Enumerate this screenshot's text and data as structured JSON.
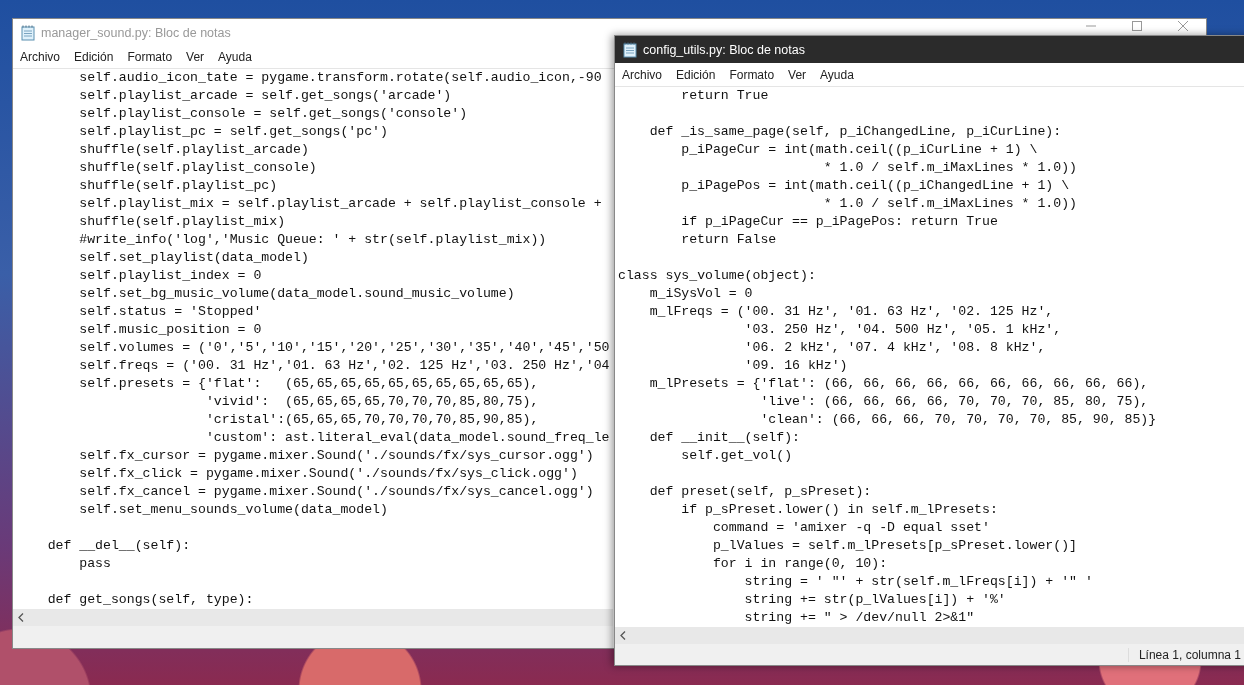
{
  "windows": [
    {
      "title": "manager_sound.py: Bloc de notas",
      "active": false,
      "menu": [
        "Archivo",
        "Edición",
        "Formato",
        "Ver",
        "Ayuda"
      ],
      "blocks": [
        [
          "        self.audio_icon_tate = pygame.transform.rotate(self.audio_icon,-90",
          "        self.playlist_arcade = self.get_songs('arcade')",
          "        self.playlist_console = self.get_songs('console')",
          "        self.playlist_pc = self.get_songs('pc')",
          "        shuffle(self.playlist_arcade)",
          "        shuffle(self.playlist_console)",
          "        shuffle(self.playlist_pc)",
          "        self.playlist_mix = self.playlist_arcade + self.playlist_console +",
          "        shuffle(self.playlist_mix)",
          "        #write_info('log','Music Queue: ' + str(self.playlist_mix))",
          "        self.set_playlist(data_model)",
          "        self.playlist_index = 0",
          "        self.set_bg_music_volume(data_model.sound_music_volume)",
          "        self.status = 'Stopped'",
          "        self.music_position = 0",
          "        self.volumes = ('0','5','10','15','20','25','30','35','40','45','50",
          "        self.freqs = ('00. 31 Hz','01. 63 Hz','02. 125 Hz','03. 250 Hz','04",
          "        self.presets = {'flat':   (65,65,65,65,65,65,65,65,65,65),",
          "                        'vivid':  (65,65,65,65,70,70,70,85,80,75),",
          "                        'cristal':(65,65,65,70,70,70,70,85,90,85),",
          "                        'custom': ast.literal_eval(data_model.sound_freq_le",
          "        self.fx_cursor = pygame.mixer.Sound('./sounds/fx/sys_cursor.ogg')",
          "        self.fx_click = pygame.mixer.Sound('./sounds/fx/sys_click.ogg')",
          "        self.fx_cancel = pygame.mixer.Sound('./sounds/fx/sys_cancel.ogg')",
          "        self.set_menu_sounds_volume(data_model)"
        ],
        [
          "    def __del__(self):",
          "        pass"
        ],
        [
          "    def get_songs(self, type):"
        ]
      ]
    },
    {
      "title": "config_utils.py: Bloc de notas",
      "active": true,
      "menu": [
        "Archivo",
        "Edición",
        "Formato",
        "Ver",
        "Ayuda"
      ],
      "blocks": [
        [
          "        return True"
        ],
        [
          "    def _is_same_page(self, p_iChangedLine, p_iCurLine):",
          "        p_iPageCur = int(math.ceil((p_iCurLine + 1) \\",
          "                          * 1.0 / self.m_iMaxLines * 1.0))",
          "        p_iPagePos = int(math.ceil((p_iChangedLine + 1) \\",
          "                          * 1.0 / self.m_iMaxLines * 1.0))",
          "        if p_iPageCur == p_iPagePos: return True",
          "        return False"
        ],
        [
          "class sys_volume(object):",
          "    m_iSysVol = 0",
          "    m_lFreqs = ('00. 31 Hz', '01. 63 Hz', '02. 125 Hz',",
          "                '03. 250 Hz', '04. 500 Hz', '05. 1 kHz',",
          "                '06. 2 kHz', '07. 4 kHz', '08. 8 kHz',",
          "                '09. 16 kHz')",
          "    m_lPresets = {'flat': (66, 66, 66, 66, 66, 66, 66, 66, 66, 66),",
          "                  'live': (66, 66, 66, 66, 70, 70, 70, 85, 80, 75),",
          "                  'clean': (66, 66, 66, 70, 70, 70, 70, 85, 90, 85)}",
          "    def __init__(self):",
          "        self.get_vol()"
        ],
        [
          "    def preset(self, p_sPreset):",
          "        if p_sPreset.lower() in self.m_lPresets:",
          "            command = 'amixer -q -D equal sset'",
          "            p_lValues = self.m_lPresets[p_sPreset.lower()]",
          "            for i in range(0, 10):",
          "                string = ' \"' + str(self.m_lFreqs[i]) + '\" '",
          "                string += str(p_lValues[i]) + '%'",
          "                string += \" > /dev/null 2>&1\""
        ]
      ],
      "status": "Línea 1, columna 1"
    }
  ]
}
